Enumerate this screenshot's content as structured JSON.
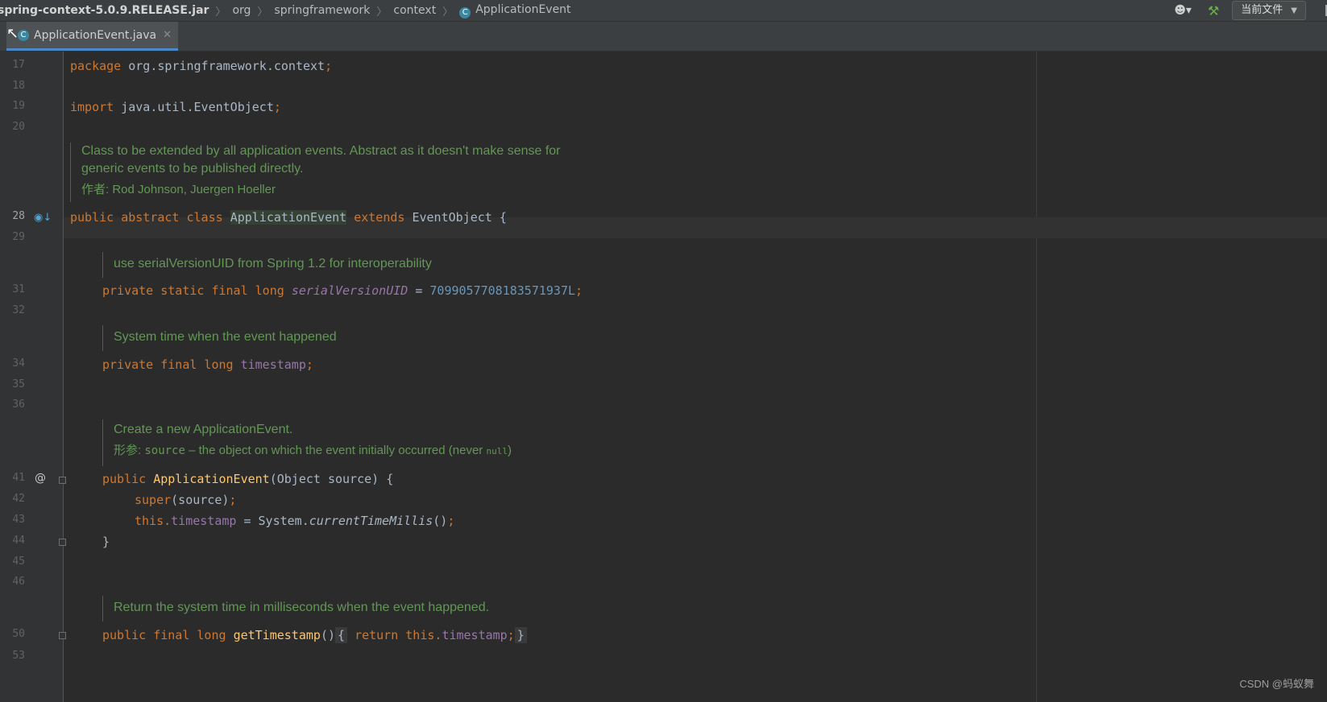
{
  "breadcrumb": {
    "items": [
      "spring-context-5.0.9.RELEASE.jar",
      "org",
      "springframework",
      "context",
      "ApplicationEvent"
    ],
    "class_icon": "C"
  },
  "toolbar": {
    "user_icon": "user-dropdown-icon",
    "build_icon": "hammer-icon",
    "scope_label": "当前文件"
  },
  "tab": {
    "label": "ApplicationEvent.java",
    "icon": "C"
  },
  "doc": {
    "class_line1": "Class to be extended by all application events. Abstract as it doesn't make sense for",
    "class_line2": "generic events to be published directly.",
    "class_author": "作者: Rod Johnson, Juergen Hoeller",
    "serial": "use serialVersionUID from Spring 1.2 for interoperability",
    "timestamp": "System time when the event happened",
    "ctor_line1": "Create a new ApplicationEvent.",
    "ctor_param_label": "形参:",
    "ctor_param_name": "source",
    "ctor_param_desc": " – the object on which the event initially occurred (never ",
    "ctor_param_null": "null",
    "ctor_param_end": ")",
    "getter": "Return the system time in milliseconds when the event happened."
  },
  "line_numbers": [
    "17",
    "18",
    "19",
    "20",
    "28",
    "29",
    "31",
    "32",
    "34",
    "35",
    "36",
    "41",
    "42",
    "43",
    "44",
    "45",
    "46",
    "50",
    "53"
  ],
  "code": {
    "l17": {
      "kw": "package",
      "rest": " org.springframework.context",
      "semi": ";"
    },
    "l19": {
      "kw": "import",
      "rest": " java.util.EventObject",
      "semi": ";"
    },
    "l28": {
      "kw1": "public abstract class",
      "cls": "ApplicationEvent",
      "kw2": "extends",
      "rest": " EventObject {"
    },
    "l31": {
      "kw": "private static final long",
      "name": "serialVersionUID",
      "eq": " = ",
      "num": "7099057708183571937L",
      "semi": ";"
    },
    "l34": {
      "kw": "private final long",
      "name": "timestamp",
      "semi": ";"
    },
    "l41": {
      "kw": "public",
      "fn": "ApplicationEvent",
      "rest": "(Object source) {"
    },
    "l42": {
      "kw": "super",
      "rest": "(source)",
      "semi": ";"
    },
    "l43": {
      "kw": "this",
      "dot": ".",
      "field": "timestamp",
      "eq": " = System.",
      "call": "currentTimeMillis",
      "end": "()",
      "semi": ";"
    },
    "l44": {
      "rest": "}"
    },
    "l50": {
      "kw": "public final long",
      "fn": "getTimestamp",
      "paren": "()",
      "open": "{",
      "kw2": "return",
      "this": "this",
      "dot": ".",
      "field": "timestamp",
      "semi": ";",
      "close": "}"
    }
  },
  "watermark": "CSDN @蚂蚁舞"
}
